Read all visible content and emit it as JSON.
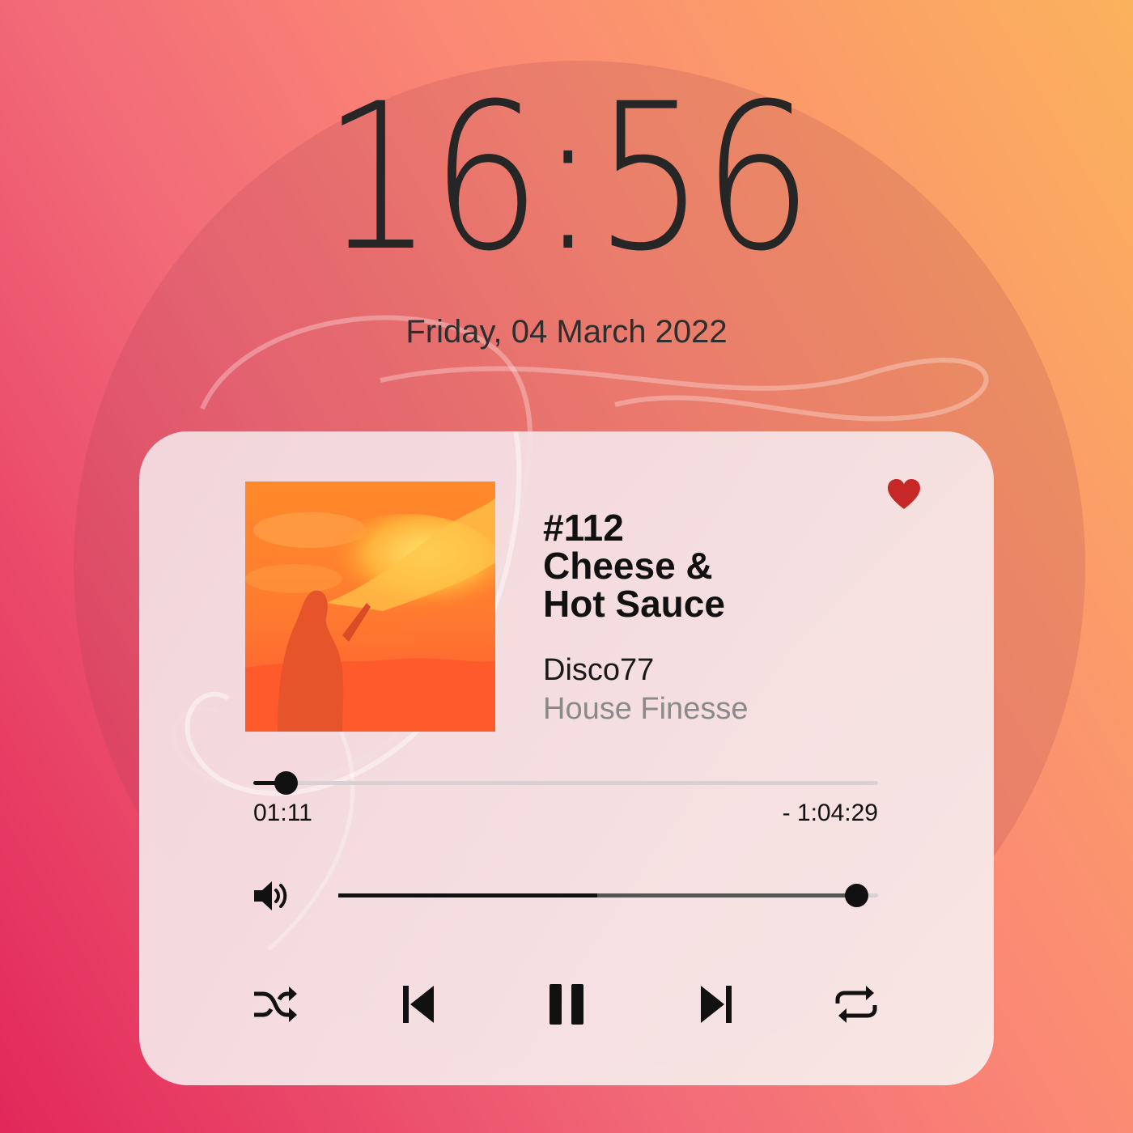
{
  "lockscreen": {
    "time": "16:56",
    "date": "Friday, 04 March 2022"
  },
  "player": {
    "episode": "#112",
    "title_line1": "Cheese &",
    "title_line2": "Hot Sauce",
    "artist": "Disco77",
    "album": "House Finesse",
    "favorite": true,
    "progress": {
      "elapsed": "01:11",
      "remaining": "- 1:04:29",
      "fraction": 0.052
    },
    "volume": {
      "level": 0.96,
      "secondary_level": 0.48
    },
    "controls": [
      "shuffle-icon",
      "previous-icon",
      "pause-icon",
      "next-icon",
      "repeat-icon"
    ]
  },
  "colors": {
    "accent_heart": "#c62828",
    "text_dark": "#111111",
    "text_muted": "#8a8a8a",
    "background_start": "#e2275a",
    "background_end": "#fbb25c"
  }
}
